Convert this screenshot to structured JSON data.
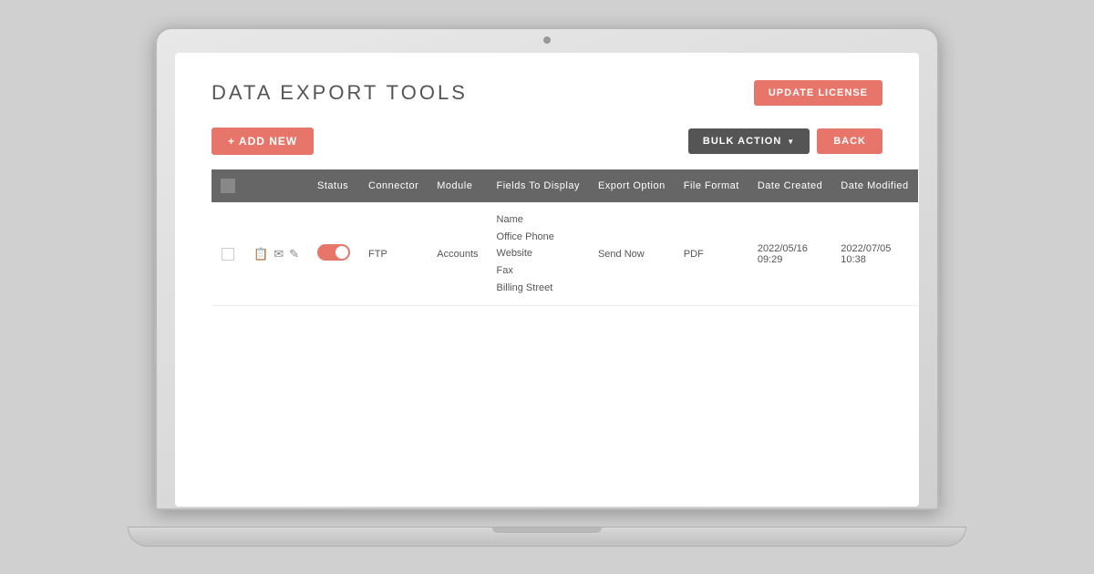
{
  "page": {
    "title": "DATA EXPORT TOOLS",
    "update_license_label": "UPDATE LICENSE",
    "add_new_label": "+ ADD NEW",
    "bulk_action_label": "BULK ACTION",
    "back_label": "BACK"
  },
  "table": {
    "columns": [
      {
        "key": "checkbox",
        "label": ""
      },
      {
        "key": "actions",
        "label": ""
      },
      {
        "key": "status",
        "label": "Status"
      },
      {
        "key": "connector",
        "label": "Connector"
      },
      {
        "key": "module",
        "label": "Module"
      },
      {
        "key": "fields_to_display",
        "label": "Fields To Display"
      },
      {
        "key": "export_option",
        "label": "Export Option"
      },
      {
        "key": "file_format",
        "label": "File Format"
      },
      {
        "key": "date_created",
        "label": "Date Created"
      },
      {
        "key": "date_modified",
        "label": "Date Modified"
      }
    ],
    "rows": [
      {
        "id": 1,
        "status": "active",
        "connector": "FTP",
        "module": "Accounts",
        "fields_to_display": [
          "Name",
          "Office Phone",
          "Website",
          "Fax",
          "Billing Street"
        ],
        "export_option": "Send Now",
        "file_format": "PDF",
        "date_created": "2022/05/16 09:29",
        "date_modified": "2022/07/05 10:38"
      }
    ]
  }
}
